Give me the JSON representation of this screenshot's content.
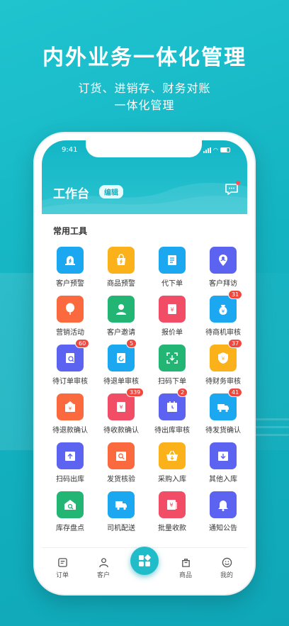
{
  "headline": "内外业务一体化管理",
  "subline1": "订货、进销存、财务对账",
  "subline2": "一体化管理",
  "status": {
    "time": "9:41"
  },
  "header": {
    "title": "工作台",
    "edit_label": "编辑"
  },
  "section_title": "常用工具",
  "colors": {
    "accent": "#14b3c2",
    "badge": "#f0483e"
  },
  "tools": [
    {
      "label": "客户预警",
      "icon": "alarm-icon",
      "color": "#1ba8f0"
    },
    {
      "label": "商品预警",
      "icon": "bag-icon",
      "color": "#fbb21a"
    },
    {
      "label": "代下单",
      "icon": "order-icon",
      "color": "#1ba8f0"
    },
    {
      "label": "客户拜访",
      "icon": "location-user-icon",
      "color": "#5b63f0"
    },
    {
      "label": "营销活动",
      "icon": "balloon-icon",
      "color": "#fb6a3f"
    },
    {
      "label": "客户邀请",
      "icon": "user-icon",
      "color": "#22b573"
    },
    {
      "label": "报价单",
      "icon": "quote-icon",
      "color": "#f24d66"
    },
    {
      "label": "待商机审核",
      "icon": "money-bag-icon",
      "color": "#1ba8f0",
      "badge": "31"
    },
    {
      "label": "待订单审核",
      "icon": "order-review-icon",
      "color": "#5b63f0",
      "badge": "60"
    },
    {
      "label": "待退单审核",
      "icon": "return-icon",
      "color": "#1ba8f0",
      "badge": "5"
    },
    {
      "label": "扫码下单",
      "icon": "scan-icon",
      "color": "#22b573"
    },
    {
      "label": "待财务审核",
      "icon": "shield-icon",
      "color": "#fbb21a",
      "badge": "37"
    },
    {
      "label": "待退款确认",
      "icon": "refund-icon",
      "color": "#fb6a3f"
    },
    {
      "label": "待收款确认",
      "icon": "receipt-icon",
      "color": "#f24d66",
      "badge": "339"
    },
    {
      "label": "待出库审核",
      "icon": "calendar-icon",
      "color": "#5b63f0",
      "badge": "2"
    },
    {
      "label": "待发货确认",
      "icon": "truck-icon",
      "color": "#1ba8f0",
      "badge": "41"
    },
    {
      "label": "扫码出库",
      "icon": "upload-box-icon",
      "color": "#5b63f0"
    },
    {
      "label": "发货核验",
      "icon": "search-box-icon",
      "color": "#fb6a3f"
    },
    {
      "label": "采购入库",
      "icon": "basket-icon",
      "color": "#fbb21a"
    },
    {
      "label": "其他入库",
      "icon": "download-box-icon",
      "color": "#5b63f0"
    },
    {
      "label": "库存盘点",
      "icon": "warehouse-icon",
      "color": "#22b573"
    },
    {
      "label": "司机配送",
      "icon": "delivery-truck-icon",
      "color": "#1ba8f0"
    },
    {
      "label": "批量收款",
      "icon": "batch-receipt-icon",
      "color": "#f24d66"
    },
    {
      "label": "通知公告",
      "icon": "bell-icon",
      "color": "#5b63f0"
    }
  ],
  "tabs": [
    {
      "label": "订单",
      "icon": "order-tab-icon"
    },
    {
      "label": "客户",
      "icon": "customer-tab-icon"
    },
    {
      "label": "",
      "icon": "apps-fab-icon"
    },
    {
      "label": "商品",
      "icon": "product-tab-icon"
    },
    {
      "label": "我的",
      "icon": "me-tab-icon"
    }
  ]
}
